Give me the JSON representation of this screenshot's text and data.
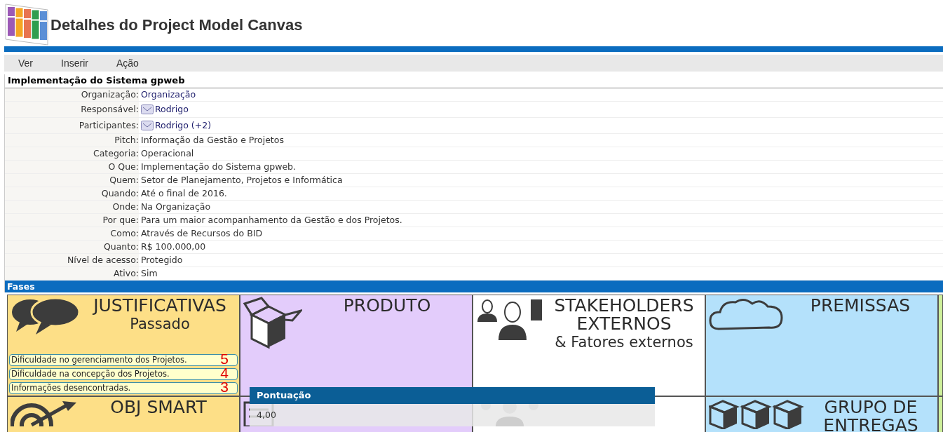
{
  "header": {
    "title": "Detalhes do Project Model Canvas"
  },
  "menu": [
    {
      "label": "Ver"
    },
    {
      "label": "Inserir"
    },
    {
      "label": "Ação"
    }
  ],
  "project": {
    "title": "Implementação do Sistema gpweb",
    "fields": [
      {
        "label": "Organização:",
        "value": "Organização",
        "kind": "link"
      },
      {
        "label": "Responsável:",
        "value": "Rodrigo",
        "kind": "user"
      },
      {
        "label": "Participantes:",
        "value": "Rodrigo (+2)",
        "kind": "user"
      },
      {
        "label": "Pitch:",
        "value": "Informação da Gestão e Projetos",
        "kind": "text"
      },
      {
        "label": "Categoria:",
        "value": "Operacional",
        "kind": "text"
      },
      {
        "label": "O Que:",
        "value": "Implementação do Sistema gpweb.",
        "kind": "text"
      },
      {
        "label": "Quem:",
        "value": "Setor de Planejamento, Projetos e Informática",
        "kind": "text"
      },
      {
        "label": "Quando:",
        "value": "Até o final de 2016.",
        "kind": "text"
      },
      {
        "label": "Onde:",
        "value": "Na Organização",
        "kind": "text"
      },
      {
        "label": "Por que:",
        "value": "Para um maior acompanhamento da Gestão e dos Projetos.",
        "kind": "text"
      },
      {
        "label": "Como:",
        "value": "Através de Recursos do BID",
        "kind": "text"
      },
      {
        "label": "Quanto:",
        "value": "R$ 100.000,00",
        "kind": "text"
      },
      {
        "label": "Nível de acesso:",
        "value": "Protegido",
        "kind": "text"
      },
      {
        "label": "Ativo:",
        "value": "Sim",
        "kind": "text"
      }
    ]
  },
  "section": {
    "title": "Fases"
  },
  "canvas": {
    "cells": [
      {
        "kind": "bubbles",
        "title": "JUSTIFICATIVAS",
        "subtitle": "Passado",
        "color": "#fddf87",
        "items": [
          {
            "text": "Dificuldade no gerenciamento dos Projetos.",
            "score": "5"
          },
          {
            "text": "Dificuldade na concepção dos Projetos.",
            "score": "4"
          },
          {
            "text": "Informações desencontradas.",
            "score": "3"
          }
        ]
      },
      {
        "kind": "box",
        "title": "PRODUTO",
        "color": "#e3ccfb"
      },
      {
        "kind": "people",
        "title": "STAKEHOLDERS EXTERNOS",
        "subtitle": "& Fatores externos",
        "color": "#ffffff"
      },
      {
        "kind": "cloud",
        "title": "PREMISSAS",
        "color": "#b4e1fb"
      },
      {
        "kind": "blank",
        "color": "#cdef9a"
      },
      {
        "kind": "target",
        "title": "OBJ SMART",
        "color": "#fddf87"
      },
      {
        "kind": "list",
        "color": "#e3ccfb"
      },
      {
        "kind": "team"
      },
      {
        "kind": "boxes",
        "title": "GRUPO DE ENTREGAS",
        "color": "#b4e1fb"
      },
      {
        "kind": "blank",
        "color": "#cdef9a"
      }
    ]
  },
  "tooltip": {
    "title": "Pontuação",
    "value": "4,00"
  }
}
